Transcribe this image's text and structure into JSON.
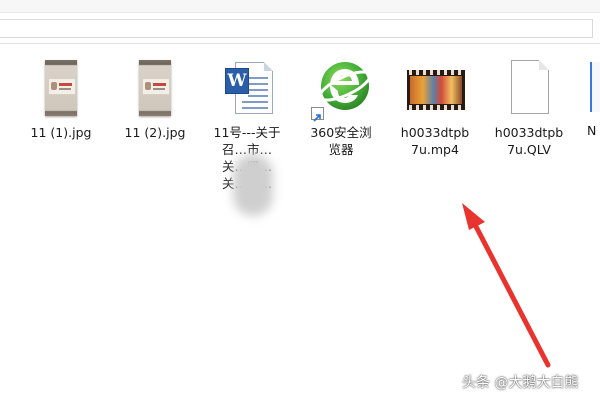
{
  "files": [
    {
      "name": "11 (1).jpg",
      "icon": "jpg-thumbnail-icon"
    },
    {
      "name": "11 (2).jpg",
      "icon": "jpg-thumbnail-icon"
    },
    {
      "name": "11号---关于召…市…关…坚…关…知…",
      "icon": "word-document-icon"
    },
    {
      "name": "360安全浏览器",
      "icon": "360-browser-shortcut-icon"
    },
    {
      "name": "h0033dtpb7u.mp4",
      "icon": "video-thumbnail-icon"
    },
    {
      "name": "h0033dtpb7u.QLV",
      "icon": "generic-file-icon"
    }
  ],
  "edge_file": {
    "name": "N"
  },
  "watermark": "头条 @大鹅大白熊",
  "colors": {
    "arrow": "#e8332f",
    "word_blue": "#2b5ea8",
    "browser_green": "#49b33a"
  }
}
